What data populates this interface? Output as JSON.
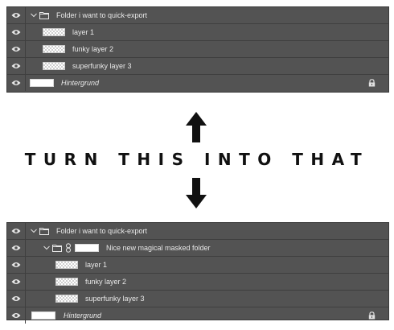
{
  "before_panel": {
    "rows": [
      {
        "label": "Folder i want to quick-export"
      },
      {
        "label": "layer 1"
      },
      {
        "label": "funky layer 2"
      },
      {
        "label": "superfunky layer 3"
      },
      {
        "label": "Hintergrund"
      }
    ]
  },
  "caption": "TURN THIS INTO THAT",
  "after_panel": {
    "rows": [
      {
        "label": "Folder i want to quick-export"
      },
      {
        "label": "Nice new magical masked folder"
      },
      {
        "label": "layer 1"
      },
      {
        "label": "funky layer 2"
      },
      {
        "label": "superfunky layer 3"
      },
      {
        "label": "Hintergrund"
      }
    ]
  },
  "icons": {
    "visibility": "eye-icon",
    "expand": "chevron-down-icon",
    "folder": "folder-icon",
    "lock": "lock-icon",
    "mask_link": "chain-link-icon",
    "arrows": [
      "arrow-up-icon",
      "arrow-down-icon"
    ]
  },
  "colors": {
    "panel_bg": "#535353",
    "panel_divider": "#3f3f3f",
    "text": "#e8e8e8",
    "caption": "#111111"
  }
}
